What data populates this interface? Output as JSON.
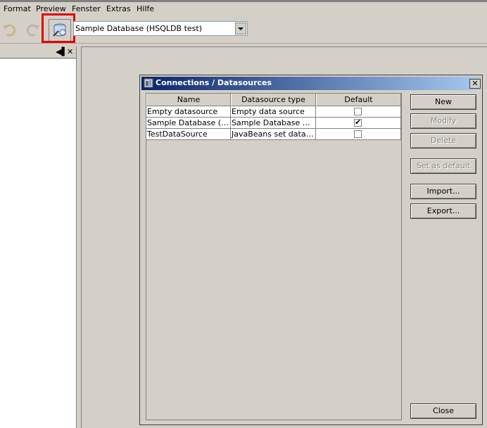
{
  "menubar": {
    "items": [
      "Format",
      "Preview",
      "Fenster",
      "Extras",
      "Hilfe"
    ]
  },
  "toolbar": {
    "undo_icon": "undo-icon",
    "redo_icon": "redo-icon",
    "datasource_icon": "database-connection-icon",
    "datasource_combo_value": "Sample Database (HSQLDB test)"
  },
  "left_panel": {
    "pin_icon": "panel-pin-icon",
    "close_icon": "close-icon",
    "pin_glyph": "◀▌",
    "close_glyph": "✕"
  },
  "dialog": {
    "title": "Connections / Datasources",
    "close_glyph": "✕",
    "columns": [
      "Name",
      "Datasource type",
      "Default"
    ],
    "rows": [
      {
        "name": "Empty datasource",
        "type": "Empty data source",
        "default": false
      },
      {
        "name": "Sample Database (HS...",
        "type": "Sample Database Con...",
        "default": true
      },
      {
        "name": "TestDataSource",
        "type": "JavaBeans set dataso...",
        "default": false
      }
    ],
    "check_glyph": "✔",
    "buttons": {
      "new": "New",
      "modify": "Modify",
      "delete": "Delete",
      "set_default": "Set as default",
      "import": "Import...",
      "export": "Export...",
      "close": "Close"
    }
  },
  "colors": {
    "title_gradient_start": "#0a246a",
    "title_gradient_end": "#a6caf0",
    "highlight": "#e00000",
    "window_bg": "#d4d0c8"
  }
}
